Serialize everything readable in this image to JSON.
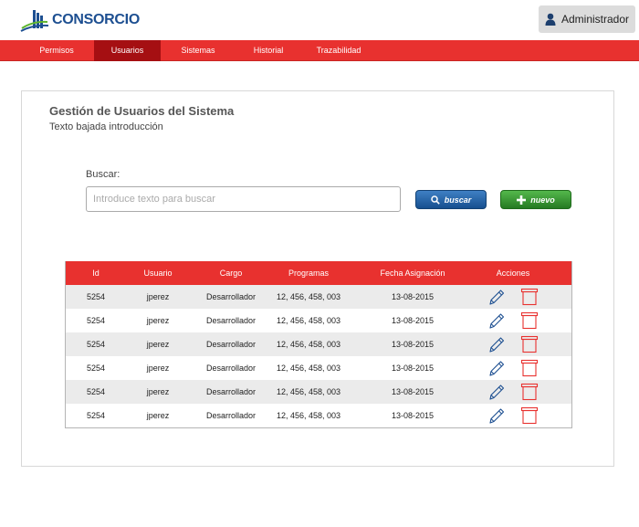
{
  "header": {
    "logo_text": "CONSORCIO",
    "user_label": "Administrador"
  },
  "nav": {
    "items": [
      {
        "label": "Permisos",
        "active": false
      },
      {
        "label": "Usuarios",
        "active": true
      },
      {
        "label": "Sistemas",
        "active": false
      },
      {
        "label": "Historial",
        "active": false
      },
      {
        "label": "Trazabilidad",
        "active": false
      }
    ]
  },
  "page": {
    "title": "Gestión de Usuarios del Sistema",
    "subtitle": "Texto bajada introducción"
  },
  "search": {
    "label": "Buscar:",
    "placeholder": "Introduce texto para buscar",
    "value": "",
    "search_button": "buscar",
    "new_button": "nuevo"
  },
  "table": {
    "columns": [
      "Id",
      "Usuario",
      "Cargo",
      "Programas",
      "Fecha Asignación",
      "Acciones"
    ],
    "rows": [
      {
        "id": "5254",
        "usuario": "jperez",
        "cargo": "Desarrollador",
        "programas": "12, 456, 458, 003",
        "fecha": "13-08-2015"
      },
      {
        "id": "5254",
        "usuario": "jperez",
        "cargo": "Desarrollador",
        "programas": "12, 456, 458, 003",
        "fecha": "13-08-2015"
      },
      {
        "id": "5254",
        "usuario": "jperez",
        "cargo": "Desarrollador",
        "programas": "12, 456, 458, 003",
        "fecha": "13-08-2015"
      },
      {
        "id": "5254",
        "usuario": "jperez",
        "cargo": "Desarrollador",
        "programas": "12, 456, 458, 003",
        "fecha": "13-08-2015"
      },
      {
        "id": "5254",
        "usuario": "jperez",
        "cargo": "Desarrollador",
        "programas": "12, 456, 458, 003",
        "fecha": "13-08-2015"
      },
      {
        "id": "5254",
        "usuario": "jperez",
        "cargo": "Desarrollador",
        "programas": "12, 456, 458, 003",
        "fecha": "13-08-2015"
      }
    ],
    "action_icons": [
      "edit-pencil-icon",
      "delete-trash-icon"
    ]
  },
  "colors": {
    "brand_red": "#e8312f",
    "active_nav": "#a50f12",
    "logo_blue": "#1d4f91",
    "search_blue": "#1f5ea5",
    "new_green": "#3a9a35"
  }
}
